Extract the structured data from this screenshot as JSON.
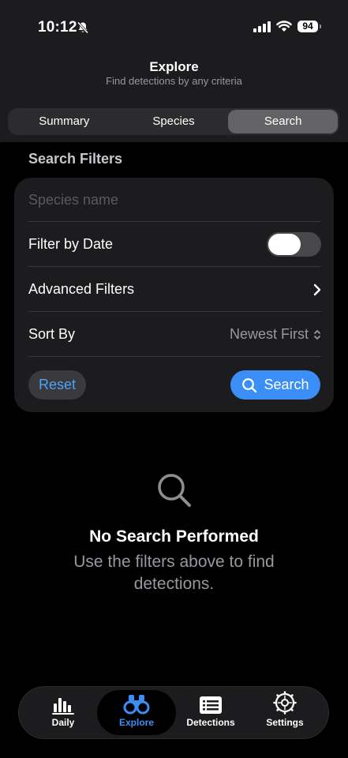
{
  "status": {
    "time": "10:12",
    "battery": "94"
  },
  "nav": {
    "title": "Explore",
    "subtitle": "Find detections by any criteria"
  },
  "segments": [
    {
      "label": "Summary",
      "active": false
    },
    {
      "label": "Species",
      "active": false
    },
    {
      "label": "Search",
      "active": true
    }
  ],
  "filters": {
    "section_label": "Search Filters",
    "species_placeholder": "Species name",
    "species_value": "",
    "filter_by_date_label": "Filter by Date",
    "filter_by_date_on": false,
    "advanced_label": "Advanced Filters",
    "sort_label": "Sort By",
    "sort_value": "Newest First",
    "reset_label": "Reset",
    "search_label": "Search"
  },
  "empty_state": {
    "icon": "magnifying-glass-icon",
    "title": "No Search Performed",
    "message": "Use the filters above to find detections."
  },
  "tabs": [
    {
      "label": "Daily",
      "icon": "bar-chart-icon",
      "active": false
    },
    {
      "label": "Explore",
      "icon": "binoculars-icon",
      "active": true
    },
    {
      "label": "Detections",
      "icon": "list-icon",
      "active": false
    },
    {
      "label": "Settings",
      "icon": "gear-icon",
      "active": false
    }
  ],
  "colors": {
    "accent": "#3b8ef5",
    "background": "#000000",
    "card": "#1c1c1e"
  }
}
